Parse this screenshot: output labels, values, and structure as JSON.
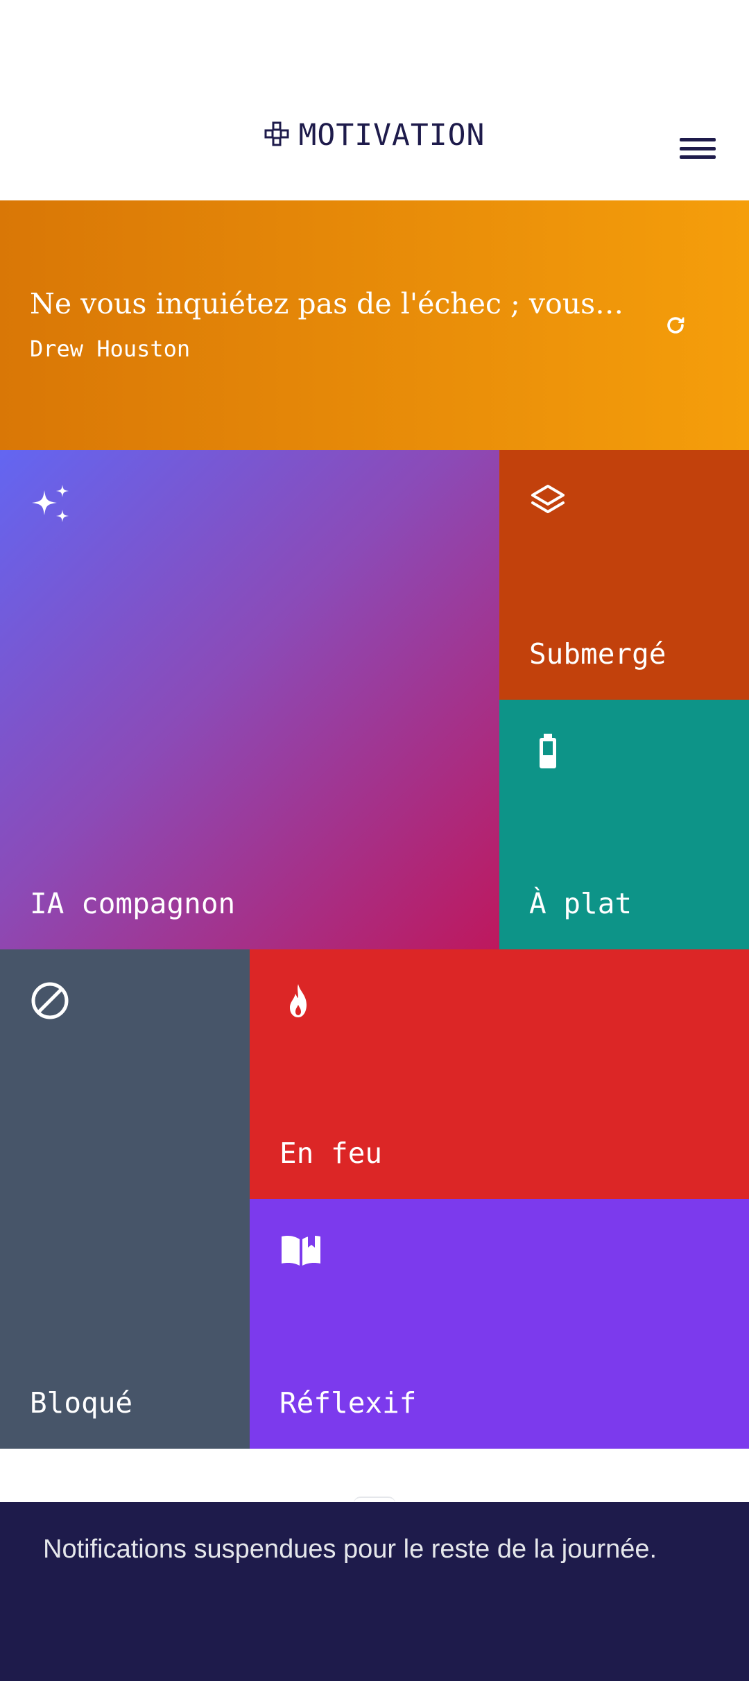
{
  "header": {
    "title": "MOTIVATION",
    "logo_icon": "gamepad-icon",
    "menu_icon": "hamburger-menu-icon"
  },
  "quote": {
    "text": "Ne vous inquiétez pas de l'échec ; vous n'...",
    "author": "Drew Houston",
    "refresh_icon": "refresh-icon"
  },
  "tiles": [
    {
      "label": "IA compagnon",
      "icon": "sparkles-icon",
      "color": "#6366f1"
    },
    {
      "label": "Submergé",
      "icon": "layers-icon",
      "color": "#c2410c"
    },
    {
      "label": "À plat",
      "icon": "battery-icon",
      "color": "#0d9488"
    },
    {
      "label": "Bloqué",
      "icon": "ban-icon",
      "color": "#475569"
    },
    {
      "label": "En feu",
      "icon": "flame-icon",
      "color": "#dc2626"
    },
    {
      "label": "Réflexif",
      "icon": "book-open-icon",
      "color": "#7c3aed"
    }
  ],
  "toast": {
    "message": "Notifications suspendues pour le reste de la journée."
  }
}
